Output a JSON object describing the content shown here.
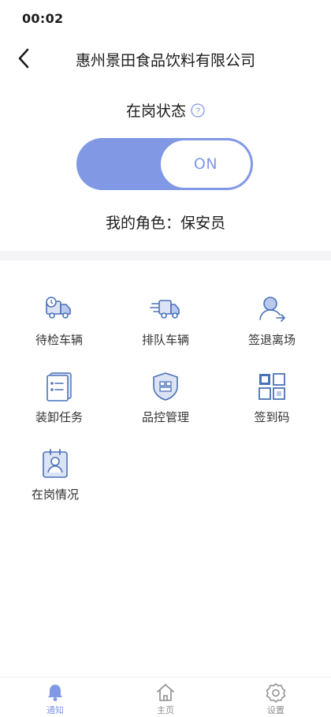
{
  "status_bar": {
    "time": "00:02"
  },
  "nav": {
    "title": "惠州景田食品饮料有限公司"
  },
  "duty": {
    "label": "在岗状态",
    "toggle_text": "ON",
    "role_text": "我的角色：保安员"
  },
  "menu": {
    "items": [
      {
        "label": "待检车辆",
        "icon": "truck-clock-icon"
      },
      {
        "label": "排队车辆",
        "icon": "truck-fast-icon"
      },
      {
        "label": "签退离场",
        "icon": "user-exit-icon"
      },
      {
        "label": "装卸任务",
        "icon": "task-list-icon"
      },
      {
        "label": "品控管理",
        "icon": "shield-grid-icon"
      },
      {
        "label": "签到码",
        "icon": "qr-code-icon"
      },
      {
        "label": "在岗情况",
        "icon": "badge-user-icon"
      }
    ]
  },
  "tabs": [
    {
      "label": "通知",
      "icon": "bell-icon",
      "active": true
    },
    {
      "label": "主页",
      "icon": "home-icon",
      "active": false
    },
    {
      "label": "设置",
      "icon": "gear-icon",
      "active": false
    }
  ],
  "colors": {
    "accent": "#8198e4",
    "icon_blue": "#4a72b8",
    "divider": "#f4f4f6"
  }
}
